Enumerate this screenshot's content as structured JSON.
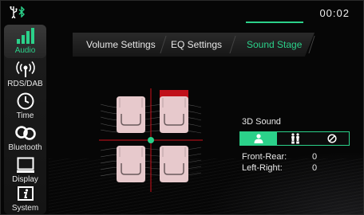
{
  "status": {
    "time": "00:02"
  },
  "sidebar": {
    "items": [
      {
        "label": "Audio",
        "icon": "equalizer-bars-icon",
        "active": true
      },
      {
        "label": "RDS/DAB",
        "icon": "radio-signal-icon"
      },
      {
        "label": "Time",
        "icon": "clock-icon"
      },
      {
        "label": "Bluetooth",
        "icon": "bluetooth-link-icon"
      },
      {
        "label": "Display",
        "icon": "display-icon"
      },
      {
        "label": "System",
        "icon": "info-icon"
      }
    ]
  },
  "tabs": [
    {
      "label": "Volume Settings"
    },
    {
      "label": "EQ Settings"
    },
    {
      "label": "Sound Stage",
      "active": true
    }
  ],
  "sound3d": {
    "label": "3D Sound",
    "modes": [
      "single-listener-icon",
      "all-seats-icon",
      "off-icon"
    ],
    "active_mode": 0
  },
  "balance": {
    "front_rear_label": "Front-Rear:",
    "front_rear_value": "0",
    "left_right_label": "Left-Right:",
    "left_right_value": "0"
  },
  "colors": {
    "accent": "#2bd18a",
    "highlight_seat": "#c0101a",
    "seat_fill": "#e7c9cc"
  }
}
